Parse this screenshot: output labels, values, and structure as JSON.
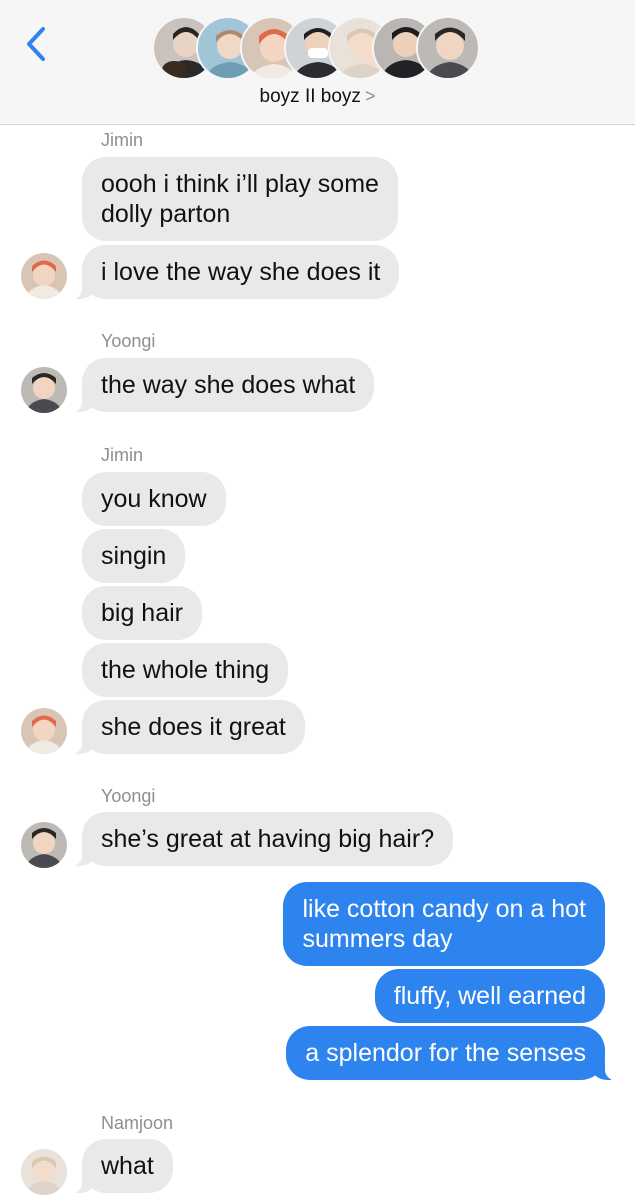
{
  "header": {
    "back_icon": "chevron-left-icon",
    "title": "boyz II boyz",
    "title_chevron": ">",
    "avatar_count": 7,
    "accent_color": "#2e84ef"
  },
  "colors": {
    "incoming_bubble": "#e9e9eb",
    "outgoing_bubble": "#2e84ef",
    "sender_name": "#8e8e93"
  },
  "messages": [
    {
      "sender": "Jimin"
    },
    {
      "text_line1": "oooh i think i’ll play some",
      "text_line2": "dolly parton"
    },
    {
      "text": "i love the way she does it"
    },
    {
      "sender": "Yoongi"
    },
    {
      "text": "the way she does what"
    },
    {
      "sender": "Jimin"
    },
    {
      "text": "you know"
    },
    {
      "text": "singin"
    },
    {
      "text": "big hair"
    },
    {
      "text": "the whole thing"
    },
    {
      "text": "she does it great"
    },
    {
      "sender": "Yoongi"
    },
    {
      "text": "she’s great at having big hair?"
    },
    {
      "text_line1": "like cotton candy on a hot",
      "text_line2": "summers day"
    },
    {
      "text": "fluffy, well earned"
    },
    {
      "text": "a splendor for the senses"
    },
    {
      "sender": "Namjoon"
    },
    {
      "text": "what"
    }
  ]
}
